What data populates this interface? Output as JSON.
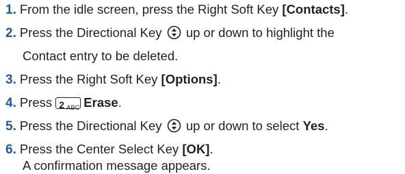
{
  "steps": [
    {
      "num": "1.",
      "pre": "From the idle screen, press the Right Soft Key ",
      "bold": "[Contacts]",
      "post": "."
    },
    {
      "num": "2.",
      "pre": "Press the Directional Key",
      "post": "up or down to highlight the",
      "cont": "Contact entry to be deleted."
    },
    {
      "num": "3.",
      "pre": "Press the Right Soft Key ",
      "bold": "[Options]",
      "post": "."
    },
    {
      "num": "4.",
      "pre": "Press",
      "key_digit": "2",
      "key_text": "ABC",
      "bold": "Erase",
      "post": "."
    },
    {
      "num": "5.",
      "pre": "Press the Directional Key",
      "post": "up or down to select ",
      "bold": "Yes",
      "post2": "."
    },
    {
      "num": "6.",
      "pre": "Press the Center Select Key ",
      "bold": "[OK]",
      "post": ".",
      "cont": "A confirmation message appears."
    }
  ],
  "colors": {
    "accent": "#1c5aa8",
    "text": "#231f20"
  },
  "icons": {
    "directional_key": "directional-key-icon",
    "key_2": "key-2-abc-icon"
  }
}
